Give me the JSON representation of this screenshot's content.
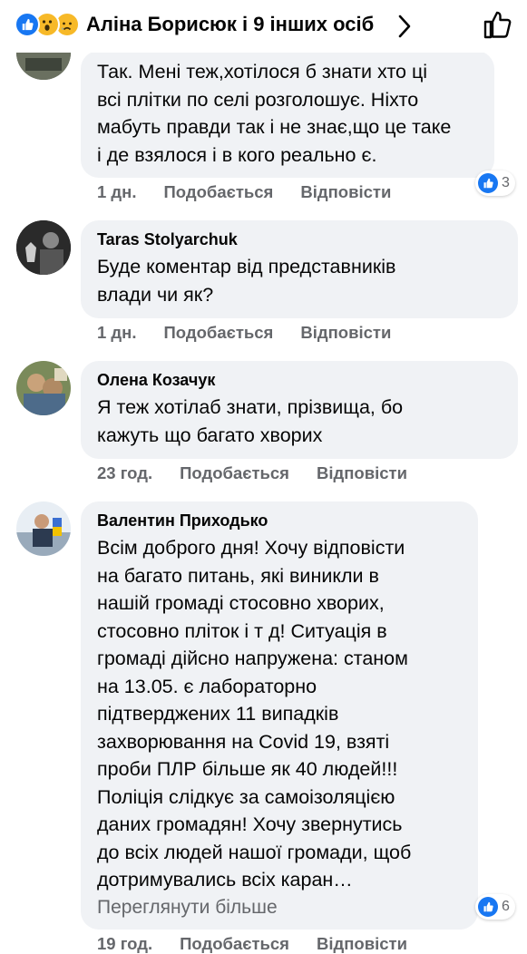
{
  "header": {
    "title": "Аліна Борисюк і 9 інших осіб",
    "reactions": [
      "like-icon",
      "wow-icon",
      "sad-icon"
    ]
  },
  "comments": [
    {
      "author": "",
      "text": "Так. Мені теж,хотілося б знати хто ці\nвсі плітки по селі розголошує. Ніхто\nмабуть правди так і не знає,що це таке\nі де взялося і в кого реально є.",
      "time": "1 дн.",
      "like_label": "Подобається",
      "reply_label": "Відповісти",
      "reaction_count": "3"
    },
    {
      "author": "Taras Stolyarchuk",
      "text": "Буде коментар від представників\nвлади чи як?",
      "time": "1 дн.",
      "like_label": "Подобається",
      "reply_label": "Відповісти"
    },
    {
      "author": "Олена Козачук",
      "text": "Я теж хотілаб знати, прізвища, бо\nкажуть що багато хворих",
      "time": "23 год.",
      "like_label": "Подобається",
      "reply_label": "Відповісти"
    },
    {
      "author": "Валентин Приходько",
      "text": "Всім доброго дня! Хочу відповісти\nна багато питань, які виникли в\nнашій громаді стосовно хворих,\nстосовно пліток і т д! Ситуація в\nгромаді дійсно напружена: станом\nна 13.05. є лабораторно\nпідтверджених 11 випадків\nзахворювання на Covid 19, взяті\nпроби ПЛР більше як 40 людей!!!\nПоліція слідкує за самоізоляцією\nданих громадян! Хочу звернутись\nдо всіх людей нашої громади, щоб\nдотримувались всіх каран…",
      "see_more": "Переглянути більше",
      "time": "19 год.",
      "like_label": "Подобається",
      "reply_label": "Відповісти",
      "reaction_count": "6"
    }
  ]
}
